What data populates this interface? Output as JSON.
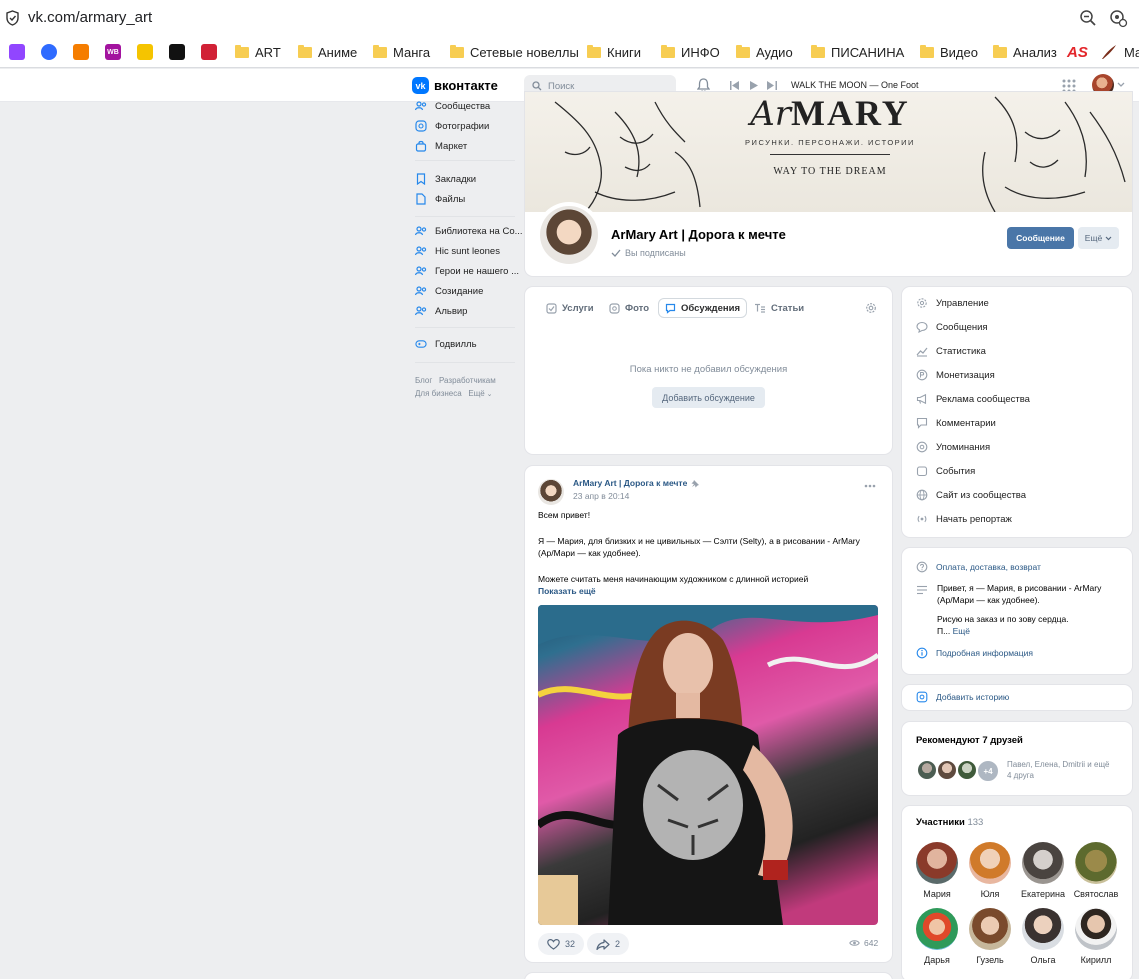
{
  "browser": {
    "url": "vk.com/armary_art",
    "bookmarks": [
      "ART",
      "Аниме",
      "Манга",
      "Сетевые новеллы",
      "Книги",
      "ИНФО",
      "Аудио",
      "ПИСАНИНА",
      "Видео",
      "Анализ"
    ],
    "ext_wb": "WB",
    "ext_as": "AS",
    "ext_tail": "Ma"
  },
  "header": {
    "logo": "вконтакте",
    "search_placeholder": "Поиск",
    "now_playing": "WALK THE MOON — One Foot"
  },
  "left_nav": {
    "items_top": [
      "Сообщества",
      "Фотографии",
      "Маркет"
    ],
    "items_mid": [
      "Закладки",
      "Файлы"
    ],
    "groups": [
      "Библиотека на Со...",
      "Hic sunt leones",
      "Герои не нашего ...",
      "Созидание",
      "Альвир"
    ],
    "apps": [
      "Годвилль"
    ],
    "footer_links": [
      "Блог",
      "Разработчикам",
      "Для бизнеса",
      "Ещё"
    ]
  },
  "cover": {
    "title_script": "Ar",
    "title_bold": "MARY",
    "tagline": "РИСУНКИ. ПЕРСОНАЖИ. ИСТОРИИ",
    "slogan": "WAY TO THE DREAM"
  },
  "group": {
    "name": "ArMary Art | Дорога к мечте",
    "status": "Вы подписаны",
    "message_button": "Сообщение",
    "more_button": "Ещё"
  },
  "tabs": {
    "items": [
      "Услуги",
      "Фото",
      "Обсуждения",
      "Статьи"
    ],
    "active": "Обсуждения",
    "empty_text": "Пока никто не добавил обсуждения",
    "add_button": "Добавить обсуждение"
  },
  "post": {
    "author": "ArMary Art | Дорога к мечте",
    "date": "23 апр в 20:14",
    "line1": "Всем привет!",
    "line2a": "Я — Мария, для близких и не цивильных — Сэлти (Selty), а в рисовании - ArMary",
    "line2b": "(Ар/Мари — как удобнее).",
    "line3": "Можете считать меня начинающим художником с длинной историей",
    "show_more": "Показать ещё",
    "likes": "32",
    "shares": "2",
    "views": "642"
  },
  "admin_menu": [
    "Управление",
    "Сообщения",
    "Статистика",
    "Монетизация",
    "Реклама сообщества",
    "Комментарии",
    "Упоминания",
    "События",
    "Сайт из сообщества",
    "Начать репортаж"
  ],
  "info": {
    "link_title": "Оплата, доставка, возврат",
    "desc_1": "Привет, я — Мария, в рисовании - ArMary",
    "desc_2": "(Ар/Мари — как удобнее).",
    "desc_3": "Рисую на заказ и по зову сердца.",
    "desc_4": "П...",
    "desc_more": "Ещё",
    "details": "Подробная информация"
  },
  "story": {
    "add": "Добавить историю"
  },
  "friends": {
    "title": "Рекомендуют 7 друзей",
    "extra": "+4",
    "names": "Павел, Елена, Dmitrii и ещё",
    "count": "4 друга"
  },
  "members": {
    "title": "Участники",
    "count": "133",
    "list": [
      "Мария",
      "Юля",
      "Екатерина",
      "Святослав",
      "Дарья",
      "Гузель",
      "Ольга",
      "Кирилл"
    ]
  }
}
